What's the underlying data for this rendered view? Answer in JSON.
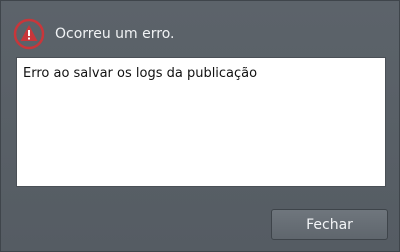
{
  "dialog": {
    "title": "Ocorreu um erro.",
    "icon": "warning-triangle-icon",
    "message": "Erro ao salvar os logs da publicação",
    "close_label": "Fechar"
  },
  "colors": {
    "background": "#585f66",
    "icon_red": "#c9363a",
    "text_light": "#f1f3f5",
    "message_bg": "#ffffff"
  }
}
